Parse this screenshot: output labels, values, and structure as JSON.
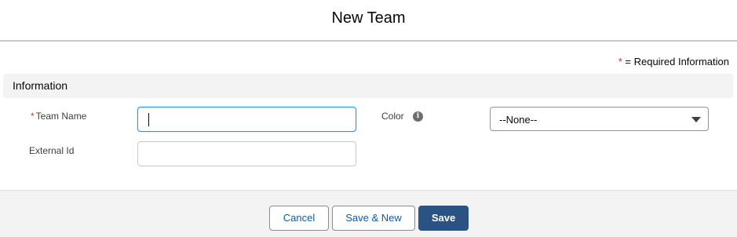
{
  "modal": {
    "title": "New Team"
  },
  "required_note": {
    "star": "*",
    "text": "= Required Information"
  },
  "section": {
    "title": "Information"
  },
  "fields": {
    "team_name": {
      "star": "*",
      "label": "Team Name",
      "value": ""
    },
    "external_id": {
      "label": "External Id",
      "value": ""
    },
    "color": {
      "label": "Color",
      "info_icon": "info-icon",
      "selected": "--None--"
    }
  },
  "buttons": {
    "cancel": "Cancel",
    "save_new": "Save & New",
    "save": "Save"
  },
  "colors": {
    "brand": "#2a5283",
    "required": "#c23934",
    "focus": "#1b96ff",
    "link": "#0b5cab"
  }
}
